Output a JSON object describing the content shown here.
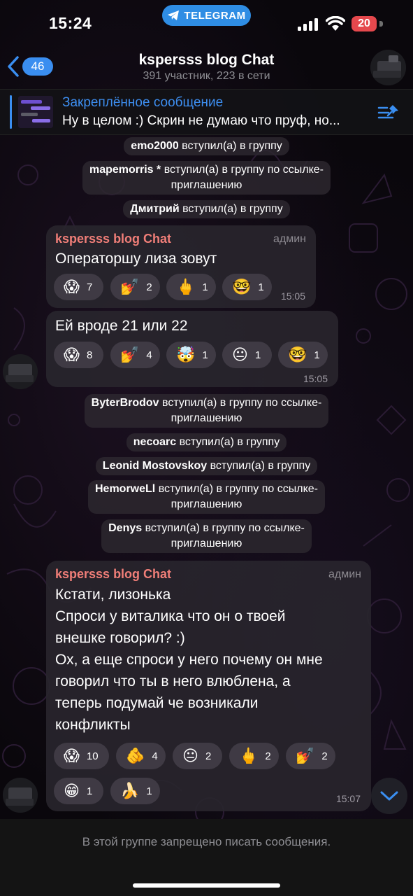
{
  "status_bar": {
    "time": "15:24",
    "app_pill": "TELEGRAM",
    "battery": "20"
  },
  "header": {
    "back_count": "46",
    "title": "kspersss blog Chat",
    "subtitle": "391 участник, 223 в сети"
  },
  "pinned": {
    "title": "Закреплённое сообщение",
    "text": "Ну в целом :) Скрин не думаю что пруф, но..."
  },
  "service": {
    "s1": {
      "name": "emo2000",
      "action": "вступил(а) в группу"
    },
    "s2": {
      "name": "mapemorris *",
      "action1": "вступил(а) в группу по ссылке-",
      "action2": "приглашению"
    },
    "s3": {
      "name": "Дмитрий",
      "action": "вступил(а) в группу"
    },
    "s4": {
      "name": "ByterBrodov",
      "action1": "вступил(а) в группу по ссылке-",
      "action2": "приглашению"
    },
    "s5": {
      "name": "necoarc",
      "action": "вступил(а) в группу"
    },
    "s6": {
      "name": "Leonid Mostovskoy",
      "action": "вступил(а) в группу"
    },
    "s7": {
      "name": "HemorweLl",
      "action1": "вступил(а) в группу по ссылке-",
      "action2": "приглашению"
    },
    "s8": {
      "name": "Denys",
      "action1": "вступил(а) в группу по ссылке-",
      "action2": "приглашению"
    }
  },
  "messages": [
    {
      "sender": "kspersss blog Chat",
      "role": "админ",
      "lines": [
        "Операторшу  лиза зовут"
      ],
      "time": "15:05",
      "reactions": [
        {
          "emoji": "😱",
          "count": "7"
        },
        {
          "emoji": "💅",
          "count": "2"
        },
        {
          "emoji": "🖕",
          "count": "1"
        },
        {
          "emoji": "🤓",
          "count": "1"
        }
      ]
    },
    {
      "lines": [
        "Ей вроде 21 или 22"
      ],
      "time": "15:05",
      "reactions": [
        {
          "emoji": "😱",
          "count": "8"
        },
        {
          "emoji": "💅",
          "count": "4"
        },
        {
          "emoji": "🤯",
          "count": "1"
        },
        {
          "emoji": "😐",
          "count": "1"
        },
        {
          "emoji": "🤓",
          "count": "1"
        }
      ]
    },
    {
      "sender": "kspersss blog Chat",
      "role": "админ",
      "lines": [
        "Кстати, лизонька",
        "Спроси у виталика что он о твоей",
        "внешке говорил? :)",
        "Ох, а еще спроси у него почему он мне",
        "говорил что ты в него влюблена, а",
        "теперь подумай че возникали",
        "конфликты"
      ],
      "time": "15:07",
      "reactions": [
        {
          "emoji": "😱",
          "count": "10"
        },
        {
          "emoji": "🫵",
          "count": "4"
        },
        {
          "emoji": "😐",
          "count": "2"
        },
        {
          "emoji": "🖕",
          "count": "2"
        },
        {
          "emoji": "💅",
          "count": "2"
        },
        {
          "emoji": "😁",
          "count": "1"
        },
        {
          "emoji": "🍌",
          "count": "1"
        }
      ]
    }
  ],
  "footer": {
    "text": "В этой группе запрещено писать сообщения."
  },
  "colors": {
    "accent": "#3a8ef0",
    "admin_name": "#f07e78",
    "battery_low": "#e5484d"
  }
}
